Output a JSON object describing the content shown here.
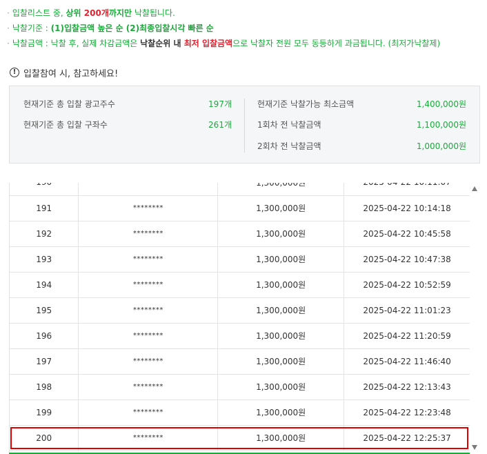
{
  "notes": {
    "line1": {
      "bullet": "·",
      "p1": "입찰리스트 중, ",
      "p2": "상위 ",
      "p3": "200개",
      "p4": "까지만",
      "p5": " 낙찰됩니다."
    },
    "line2": {
      "bullet": "·",
      "p1": "낙찰기준 : ",
      "p2": "(1)입찰금액 높은 순 (2)최종입찰시각 빠른 순"
    },
    "line3": {
      "bullet": "·",
      "p1": "낙찰금액 : 낙찰 후, 실제 차감금액은 ",
      "p2": "낙찰순위 내 ",
      "p3": "최저 입찰금액",
      "p4": "으로 낙찰자 전원 모두 동등하게 과금됩니다. (최저가낙찰제)"
    }
  },
  "notice": {
    "icon": "!",
    "text": "입찰참여 시, 참고하세요!"
  },
  "summary": {
    "left": [
      {
        "label": "현재기준 총 입찰 광고주수",
        "value": "197개"
      },
      {
        "label": "현재기준 총 입찰 구좌수",
        "value": "261개"
      }
    ],
    "right": [
      {
        "label": "현재기준 낙찰가능 최소금액",
        "value": "1,400,000원"
      },
      {
        "label": "1회차 전 낙찰금액",
        "value": "1,100,000원"
      },
      {
        "label": "2회차 전 낙찰금액",
        "value": "1,000,000원"
      }
    ]
  },
  "table": {
    "rows": [
      {
        "rank": "190",
        "bidder": "********",
        "amount": "1,300,000원",
        "time": "2025-04-22 10:11:07"
      },
      {
        "rank": "191",
        "bidder": "********",
        "amount": "1,300,000원",
        "time": "2025-04-22 10:14:18"
      },
      {
        "rank": "192",
        "bidder": "********",
        "amount": "1,300,000원",
        "time": "2025-04-22 10:45:58"
      },
      {
        "rank": "193",
        "bidder": "********",
        "amount": "1,300,000원",
        "time": "2025-04-22 10:47:38"
      },
      {
        "rank": "194",
        "bidder": "********",
        "amount": "1,300,000원",
        "time": "2025-04-22 10:52:59"
      },
      {
        "rank": "195",
        "bidder": "********",
        "amount": "1,300,000원",
        "time": "2025-04-22 11:01:23"
      },
      {
        "rank": "196",
        "bidder": "********",
        "amount": "1,300,000원",
        "time": "2025-04-22 11:20:59"
      },
      {
        "rank": "197",
        "bidder": "********",
        "amount": "1,300,000원",
        "time": "2025-04-22 11:46:40"
      },
      {
        "rank": "198",
        "bidder": "********",
        "amount": "1,300,000원",
        "time": "2025-04-22 12:13:43"
      },
      {
        "rank": "199",
        "bidder": "********",
        "amount": "1,300,000원",
        "time": "2025-04-22 12:23:48"
      },
      {
        "rank": "200",
        "bidder": "********",
        "amount": "1,300,000원",
        "time": "2025-04-22 12:25:37"
      }
    ]
  },
  "colors": {
    "accent_green": "#1aaa3a",
    "accent_red": "#e5202e",
    "highlight_border": "#e00000"
  }
}
